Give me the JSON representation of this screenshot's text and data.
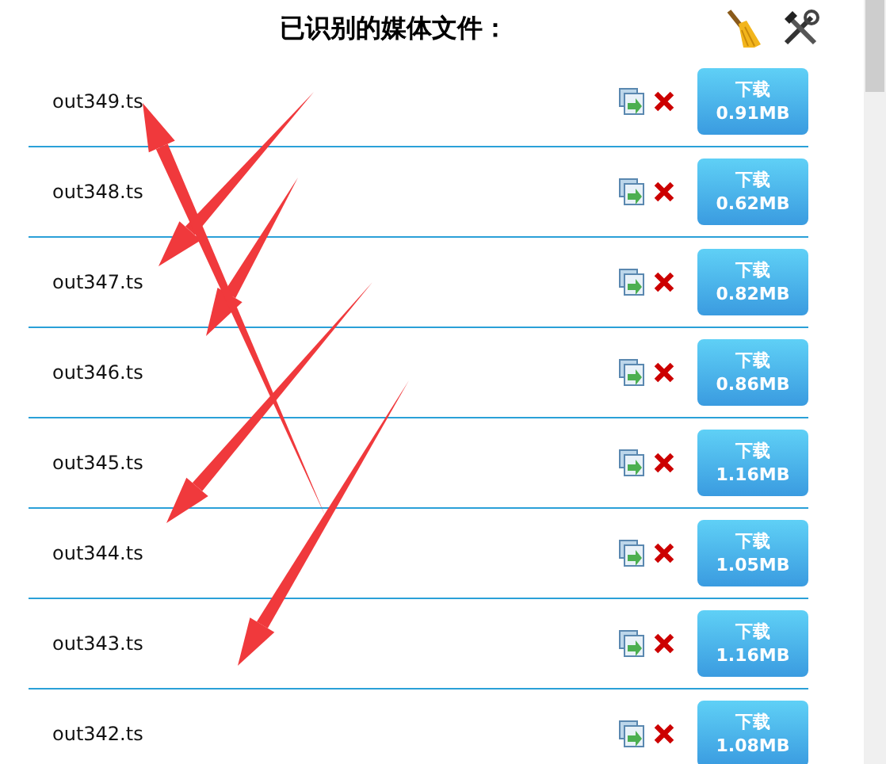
{
  "header": {
    "title": "已识别的媒体文件："
  },
  "files": [
    {
      "name": "out349.ts",
      "action": "下载",
      "size": "0.91MB"
    },
    {
      "name": "out348.ts",
      "action": "下载",
      "size": "0.62MB"
    },
    {
      "name": "out347.ts",
      "action": "下载",
      "size": "0.82MB"
    },
    {
      "name": "out346.ts",
      "action": "下载",
      "size": "0.86MB"
    },
    {
      "name": "out345.ts",
      "action": "下载",
      "size": "1.16MB"
    },
    {
      "name": "out344.ts",
      "action": "下载",
      "size": "1.05MB"
    },
    {
      "name": "out343.ts",
      "action": "下载",
      "size": "1.16MB"
    },
    {
      "name": "out342.ts",
      "action": "下载",
      "size": "1.08MB"
    }
  ]
}
